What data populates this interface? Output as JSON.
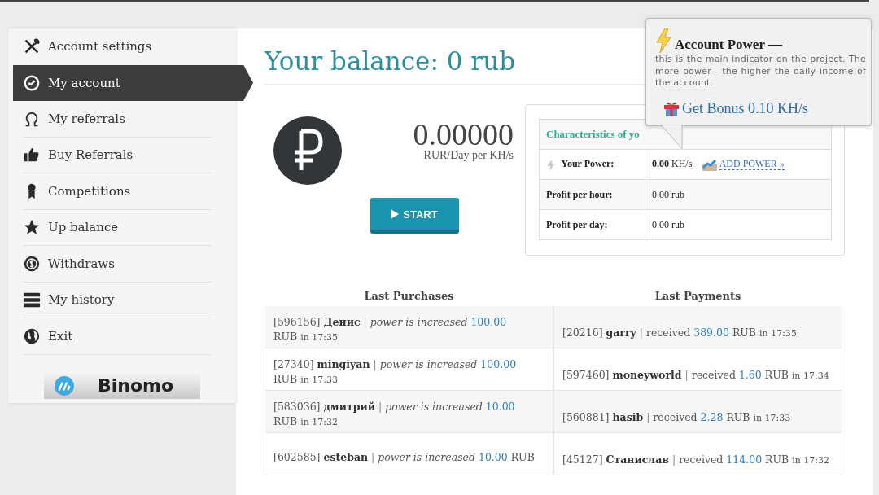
{
  "sidebar": {
    "items": [
      {
        "label": "Account settings",
        "selected": false
      },
      {
        "label": "My account",
        "selected": true
      },
      {
        "label": "My referrals",
        "selected": false
      },
      {
        "label": "Buy Referrals",
        "selected": false
      },
      {
        "label": "Competitions",
        "selected": false
      },
      {
        "label": "Up balance",
        "selected": false
      },
      {
        "label": "Withdraws",
        "selected": false
      },
      {
        "label": "My history",
        "selected": false
      },
      {
        "label": "Exit",
        "selected": false
      }
    ],
    "banner": {
      "label": "Binomo"
    }
  },
  "balance": {
    "title": "Your balance: 0 rub",
    "rate": "0.00000",
    "rate_unit": "RUR/Day per KH/s",
    "start_button": "START"
  },
  "characteristics": {
    "header": "Characteristics of yo",
    "rows": [
      {
        "kind": "power",
        "label": "Your Power:",
        "value": "**0.00** KH/s",
        "link": "ADD POWER »"
      },
      {
        "kind": "plain",
        "label": "Profit per hour:",
        "value": "0.00 rub"
      },
      {
        "kind": "plain",
        "label": "Profit per day:",
        "value": "0.00 rub"
      }
    ]
  },
  "tooltip": {
    "title": "Account Power —",
    "text": "this is the main indicator on the project. The more power - the higher the daily income of the account.",
    "bonus_link": "Get Bonus 0.10 KH/s"
  },
  "last_purchases": {
    "title": "Last Purchases",
    "rows": [
      {
        "id": "[596156]",
        "name": "Денис",
        "sep": "|",
        "action": "power is increased",
        "amount": "100.00",
        "currency": "RUB",
        "time": "in 17:35"
      },
      {
        "id": "[27340]",
        "name": "mingiyan",
        "sep": "|",
        "action": "power is increased",
        "amount": "100.00",
        "currency": "RUB",
        "time": "in 17:33"
      },
      {
        "id": "[583036]",
        "name": "дмитрий",
        "sep": "|",
        "action": "power is increased",
        "amount": "10.00",
        "currency": "RUB",
        "time": "in 17:32"
      },
      {
        "id": "[602585]",
        "name": "esteban",
        "sep": "|",
        "action": "power is increased",
        "amount": "10.00",
        "currency": "RUB"
      }
    ]
  },
  "last_payments": {
    "title": "Last Payments",
    "rows": [
      {
        "id": "[20216]",
        "name": "garry",
        "sep": "|",
        "action": "received",
        "amount": "389.00",
        "currency": "RUB",
        "time": "in 17:35"
      },
      {
        "id": "[597460]",
        "name": "moneyworld",
        "sep": "|",
        "action": "received",
        "amount": "1.60",
        "currency": "RUB",
        "time": "in 17:34"
      },
      {
        "id": "[560881]",
        "name": "hasib",
        "sep": "|",
        "action": "received",
        "amount": "2.28",
        "currency": "RUB",
        "time": "in 17:33"
      },
      {
        "id": "[45127]",
        "name": "Станислав",
        "sep": "|",
        "action": "received",
        "amount": "114.00",
        "currency": "RUB",
        "time": "in 17:32"
      }
    ]
  }
}
